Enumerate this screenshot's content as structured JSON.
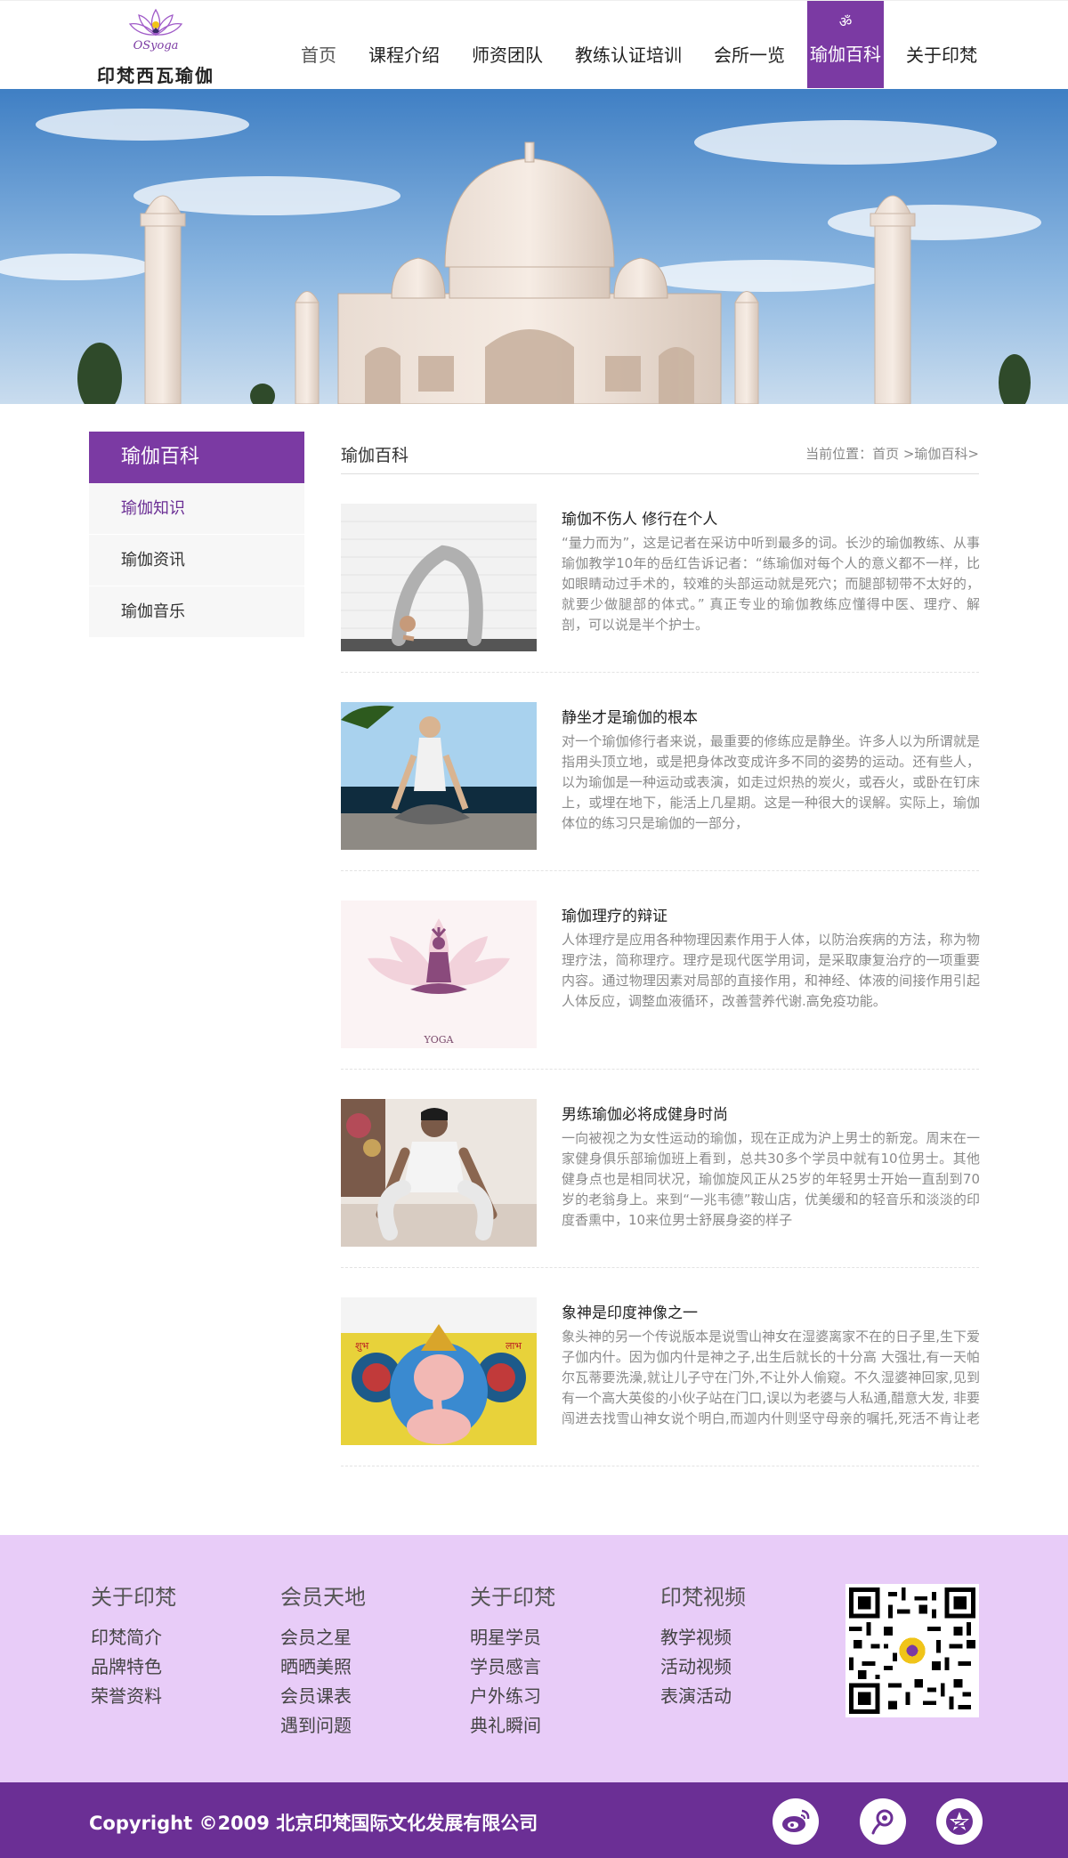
{
  "header": {
    "logo_mark_text": "OSyoga",
    "logo_text": "印梵西瓦瑜伽",
    "nav": [
      {
        "label": "首页"
      },
      {
        "label": "课程介绍"
      },
      {
        "label": "师资团队"
      },
      {
        "label": "教练认证培训"
      },
      {
        "label": "会所一览"
      },
      {
        "label": "瑜伽百科",
        "icon": "ॐ",
        "active": true
      },
      {
        "label": "关于印梵"
      }
    ]
  },
  "sidebar": {
    "title": "瑜伽百科",
    "items": [
      {
        "label": "瑜伽知识",
        "active": true
      },
      {
        "label": "瑜伽资讯"
      },
      {
        "label": "瑜伽音乐"
      }
    ]
  },
  "content": {
    "title": "瑜伽百科",
    "breadcrumb": "当前位置：首页 >瑜伽百科>",
    "articles": [
      {
        "title": "瑜伽不伤人  修行在个人",
        "body": "“量力而为”，这是记者在采访中听到最多的词。长沙的瑜伽教练、从事瑜伽教学10年的岳红告诉记者：“练瑜伽对每个人的意义都不一样，比如眼睛动过手术的，较难的头部运动就是死穴；而腿部韧带不太好的，就要少做腿部的体式。” 真正专业的瑜伽教练应懂得中医、理疗、解剖，可以说是半个护士。",
        "image": "backbend-pose-photo"
      },
      {
        "title": "静坐才是瑜伽的根本",
        "body": "对一个瑜伽修行者来说，最重要的修练应是静坐。许多人以为所谓就是指用头顶立地，或是把身体改变成许多不同的姿势的运动。还有些人，以为瑜伽是一种运动或表演，如走过炽热的炭火，或吞火，或卧在钉床上，或埋在地下，能活上几星期。这是一种很大的误解。实际上，瑜伽体位的练习只是瑜伽的一部分，",
        "image": "meditation-photo"
      },
      {
        "title": "瑜伽理疗的辩证",
        "body": "人体理疗是应用各种物理因素作用于人体，以防治疾病的方法，称为物理疗法，简称理疗。理疗是现代医学用词，是采取康复治疗的一项重要内容。通过物理因素对局部的直接作用，和神经、体液的间接作用引起人体反应，调整血液循环，改善营养代谢.高免疫功能。",
        "image": "lotus-yoga-graphic",
        "image_caption": "YOGA"
      },
      {
        "title": "男练瑜伽必将成健身时尚",
        "body": "一向被视之为女性运动的瑜伽，现在正成为沪上男士的新宠。周末在一家健身俱乐部瑜伽班上看到，总共30多个学员中就有10位男士。其他健身点也是相同状况，瑜伽旋风正从25岁的年轻男士开始一直刮到70岁的老翁身上。来到“一兆韦德”鞍山店，优美缓和的轻音乐和淡淡的印度香熏中，10来位男士舒展身姿的样子",
        "image": "male-yoga-photo"
      },
      {
        "title": "象神是印度神像之一",
        "body": "象头神的另一个传说版本是说雪山神女在湿婆离家不在的日子里,生下爱子伽内什。因为伽内什是神之子,出生后就长的十分高 大强壮,有一天帕尔瓦蒂要洗澡,就让儿子守在门外,不让外人偷窥。不久湿婆神回家,见到有一个高大英俊的小伙子站在门口,误以为老婆与人私通,醋意大发,  非要闯进去找雪山神女说个明白,而迦内什则坚守母亲的嘱托,死活不肯让老子进去。于是这对没有见面的父子",
        "image": "ganesha-artwork",
        "image_caption_left": "शुभ",
        "image_caption_right": "लाभ"
      }
    ]
  },
  "footer": {
    "columns": [
      {
        "title": "关于印梵",
        "items": [
          "印梵简介",
          "品牌特色",
          "荣誉资料"
        ]
      },
      {
        "title": "会员天地",
        "items": [
          "会员之星",
          "晒晒美照",
          "会员课表",
          "遇到问题"
        ]
      },
      {
        "title": "关于印梵",
        "items": [
          "明星学员",
          "学员感言",
          "户外练习",
          "典礼瞬间"
        ]
      },
      {
        "title": "印梵视频",
        "items": [
          "教学视频",
          "活动视频",
          "表演活动"
        ]
      }
    ],
    "qr_icon": "qr-code",
    "copyright": "Copyright ©2009  北京印梵国际文化发展有限公司",
    "social": [
      "weibo-icon",
      "tencent-weibo-icon",
      "qzone-icon"
    ]
  },
  "colors": {
    "brand_purple": "#7b3aa3",
    "footer_bg": "#e8ccf8",
    "copyright_bg": "#6b2f95"
  }
}
